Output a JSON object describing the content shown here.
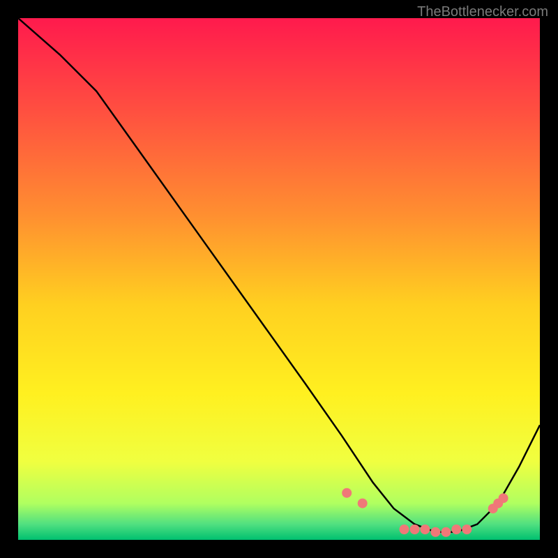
{
  "watermark": "TheBottlenecker.com",
  "chart_data": {
    "type": "line",
    "title": "",
    "xlabel": "",
    "ylabel": "",
    "xlim": [
      0,
      100
    ],
    "ylim": [
      0,
      100
    ],
    "series": [
      {
        "name": "bottleneck-curve",
        "x": [
          0,
          8,
          15,
          25,
          35,
          45,
          55,
          62,
          68,
          72,
          76,
          80,
          84,
          88,
          92,
          96,
          100
        ],
        "y": [
          100,
          93,
          86,
          72,
          58,
          44,
          30,
          20,
          11,
          6,
          3,
          1.5,
          1.5,
          3,
          7,
          14,
          22
        ]
      }
    ],
    "markers": {
      "name": "highlight-points",
      "color": "#f07878",
      "x": [
        63,
        66,
        74,
        76,
        78,
        80,
        82,
        84,
        86,
        91,
        92,
        93
      ],
      "y": [
        9,
        7,
        2,
        2,
        2,
        1.5,
        1.5,
        2,
        2,
        6,
        7,
        8
      ]
    },
    "gradient_stops": [
      {
        "offset": 0,
        "color": "#ff1a4d"
      },
      {
        "offset": 0.18,
        "color": "#ff5040"
      },
      {
        "offset": 0.38,
        "color": "#ff9030"
      },
      {
        "offset": 0.55,
        "color": "#ffd020"
      },
      {
        "offset": 0.72,
        "color": "#fff020"
      },
      {
        "offset": 0.85,
        "color": "#f0ff40"
      },
      {
        "offset": 0.93,
        "color": "#b0ff60"
      },
      {
        "offset": 0.97,
        "color": "#50e080"
      },
      {
        "offset": 1.0,
        "color": "#00c070"
      }
    ]
  }
}
